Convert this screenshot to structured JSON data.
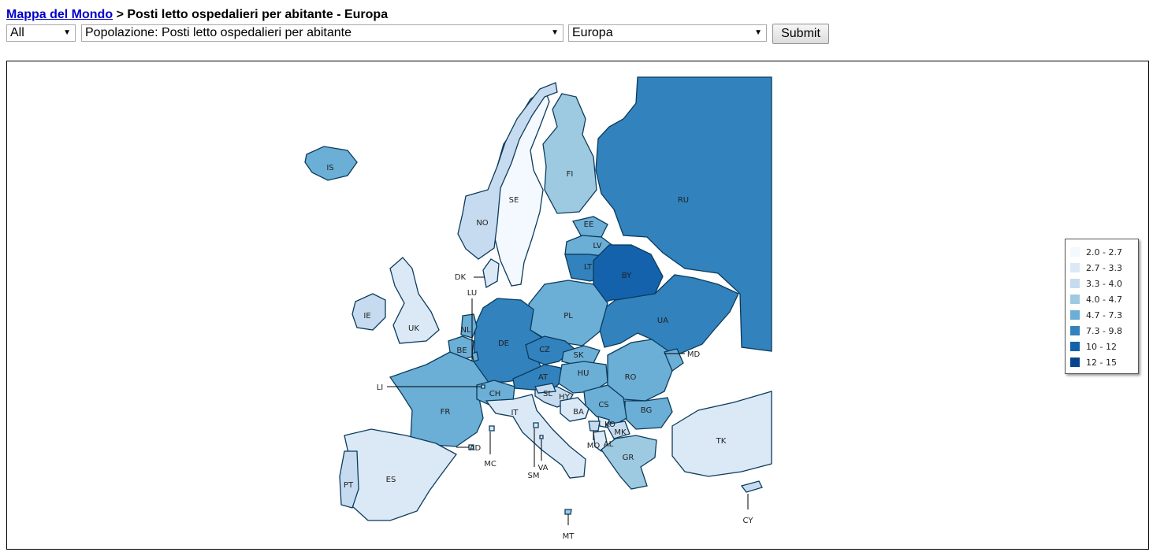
{
  "breadcrumb": {
    "link_label": "Mappa del Mondo",
    "separator": ">",
    "title": "Posti letto ospedalieri per abitante - Europa"
  },
  "filters": {
    "category": "All",
    "indicator": "Popolazione: Posti letto ospedalieri per abitante",
    "region": "Europa",
    "submit_label": "Submit"
  },
  "legend": [
    {
      "range": "2.0 - 2.7",
      "color": "#f4f9ff"
    },
    {
      "range": "2.7 - 3.3",
      "color": "#dbe9f6"
    },
    {
      "range": "3.3 - 4.0",
      "color": "#c6dbef"
    },
    {
      "range": "4.0 - 4.7",
      "color": "#9ecae1"
    },
    {
      "range": "4.7 - 7.3",
      "color": "#6baed6"
    },
    {
      "range": "7.3 - 9.8",
      "color": "#3182bd"
    },
    {
      "range": "10 - 12",
      "color": "#1462ac"
    },
    {
      "range": "12 - 15",
      "color": "#08458f"
    }
  ],
  "countries": [
    {
      "code": "IS",
      "bin": 4
    },
    {
      "code": "NO",
      "bin": 2
    },
    {
      "code": "SE",
      "bin": 0
    },
    {
      "code": "FI",
      "bin": 3
    },
    {
      "code": "RU",
      "bin": 5
    },
    {
      "code": "EE",
      "bin": 4
    },
    {
      "code": "LV",
      "bin": 4
    },
    {
      "code": "LT",
      "bin": 5
    },
    {
      "code": "BY",
      "bin": 6
    },
    {
      "code": "UA",
      "bin": 5
    },
    {
      "code": "PL",
      "bin": 4
    },
    {
      "code": "DE",
      "bin": 5
    },
    {
      "code": "DK",
      "bin": 1
    },
    {
      "code": "UK",
      "bin": 1
    },
    {
      "code": "IE",
      "bin": 2
    },
    {
      "code": "NL",
      "bin": 4
    },
    {
      "code": "BE",
      "bin": 4
    },
    {
      "code": "LU",
      "bin": 4
    },
    {
      "code": "FR",
      "bin": 4
    },
    {
      "code": "CH",
      "bin": 4
    },
    {
      "code": "AT",
      "bin": 5
    },
    {
      "code": "CZ",
      "bin": 5
    },
    {
      "code": "SK",
      "bin": 4
    },
    {
      "code": "HU",
      "bin": 4
    },
    {
      "code": "RO",
      "bin": 4
    },
    {
      "code": "MD",
      "bin": 4
    },
    {
      "code": "BG",
      "bin": 4
    },
    {
      "code": "CS",
      "bin": 4
    },
    {
      "code": "HY",
      "bin": 2
    },
    {
      "code": "SL",
      "bin": 2
    },
    {
      "code": "BA",
      "bin": 1
    },
    {
      "code": "KO",
      "bin": 1
    },
    {
      "code": "MO",
      "bin": 2
    },
    {
      "code": "AL",
      "bin": 1
    },
    {
      "code": "MK",
      "bin": 2
    },
    {
      "code": "GR",
      "bin": 3
    },
    {
      "code": "IT",
      "bin": 1
    },
    {
      "code": "ES",
      "bin": 1
    },
    {
      "code": "PT",
      "bin": 2
    },
    {
      "code": "TK",
      "bin": 1
    },
    {
      "code": "CY",
      "bin": 2
    },
    {
      "code": "MT",
      "bin": 3
    },
    {
      "code": "AD",
      "bin": 1
    },
    {
      "code": "MC",
      "bin": 1
    },
    {
      "code": "SM",
      "bin": 1
    },
    {
      "code": "VA",
      "bin": 1
    },
    {
      "code": "LI",
      "bin": 1
    }
  ],
  "colors": {
    "border": "#0b3b5c",
    "link": "#0000cc"
  }
}
